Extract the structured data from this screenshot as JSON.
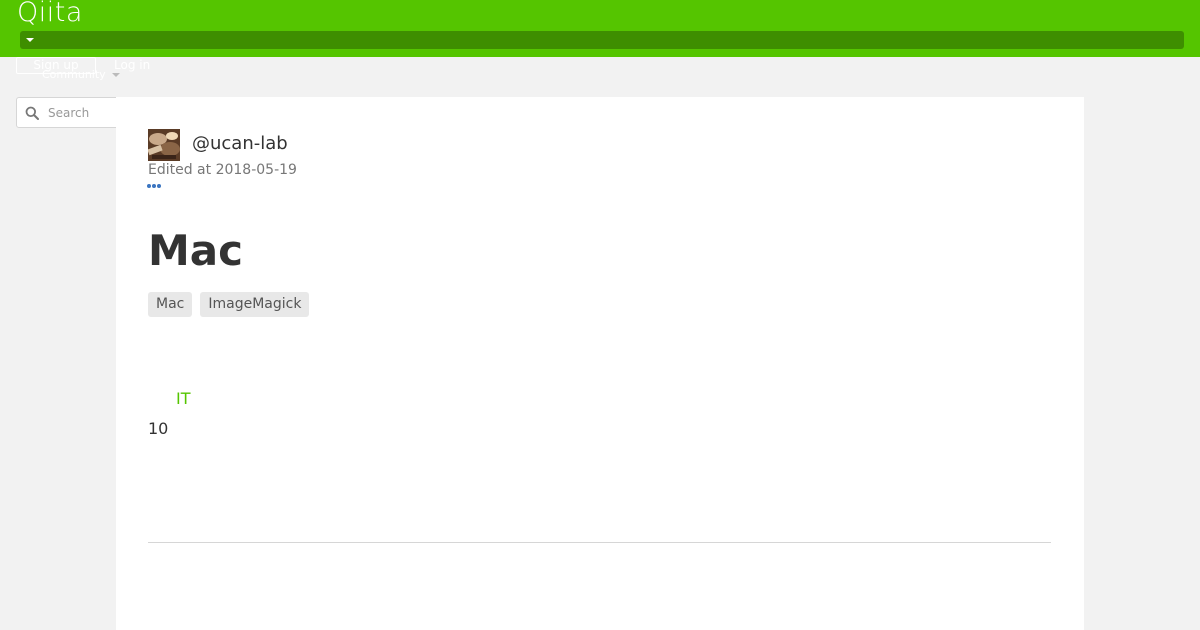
{
  "header": {
    "logo_text": "Qiita",
    "brand_color": "#55c500",
    "nav_bar_color": "#3e8e00",
    "nav_caret_icon": "caret-down-icon"
  },
  "auth": {
    "signup_label": "Sign up",
    "login_label": "Log in"
  },
  "community": {
    "label": "Community",
    "icon": "caret-down-icon"
  },
  "search": {
    "placeholder": "Search",
    "icon": "search-icon"
  },
  "article": {
    "author": "@ucan-lab",
    "edited": "Edited at 2018-05-19",
    "more_icon": "ellipsis-icon",
    "title": "Mac",
    "tags": [
      "Mac",
      "ImageMagick"
    ],
    "link_text": "IT",
    "body_text": "10",
    "link_color": "#55c500"
  }
}
